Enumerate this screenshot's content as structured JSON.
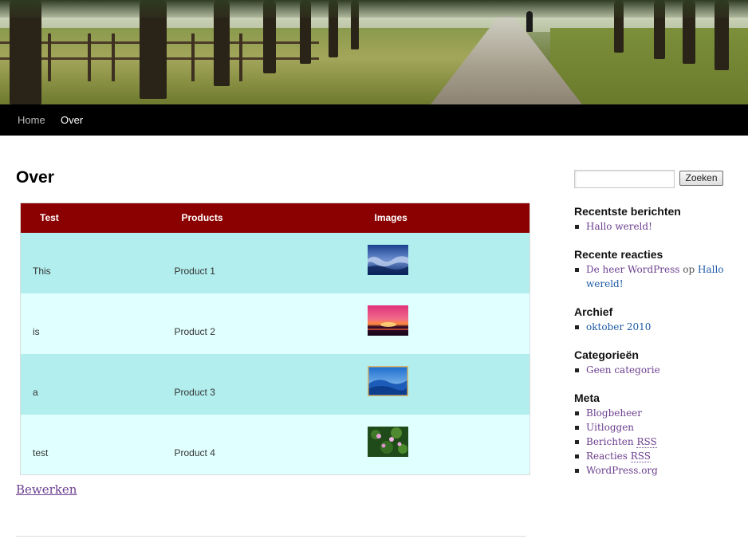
{
  "nav": {
    "home": "Home",
    "over": "Over"
  },
  "page": {
    "title": "Over",
    "edit_link": "Bewerken"
  },
  "table": {
    "headers": [
      "Test",
      "Products",
      "Images"
    ],
    "rows": [
      {
        "test": "This",
        "product": "Product 1",
        "image": "blue-water-thumbnail"
      },
      {
        "test": "is",
        "product": "Product 2",
        "image": "sunset-thumbnail"
      },
      {
        "test": "a",
        "product": "Product 3",
        "image": "blue-hills-thumbnail"
      },
      {
        "test": "test",
        "product": "Product 4",
        "image": "water-lilies-thumbnail"
      }
    ],
    "header_color": "#8b0000",
    "row_odd_color": "#b2eeee",
    "row_even_color": "#e0ffff"
  },
  "sidebar": {
    "search_button": "Zoeken",
    "recent_posts": {
      "title": "Recentste berichten",
      "items": [
        "Hallo wereld!"
      ]
    },
    "recent_comments": {
      "title": "Recente reacties",
      "author": "De heer WordPress",
      "connector": "op",
      "post_line1": "Hallo",
      "post_line2": "wereld!"
    },
    "archive": {
      "title": "Archief",
      "items": [
        "oktober 2010"
      ]
    },
    "categories": {
      "title": "Categorieën",
      "items": [
        "Geen categorie"
      ]
    },
    "meta": {
      "title": "Meta",
      "items": {
        "admin": "Blogbeheer",
        "logout": "Uitloggen",
        "posts_prefix": "Berichten",
        "comments_prefix": "Reacties",
        "rss": "RSS",
        "wordpress": "WordPress.org"
      }
    }
  },
  "colors": {
    "link": "#6b3e8e",
    "link_blue": "#1b5aa5",
    "nav_bg": "#000000"
  }
}
